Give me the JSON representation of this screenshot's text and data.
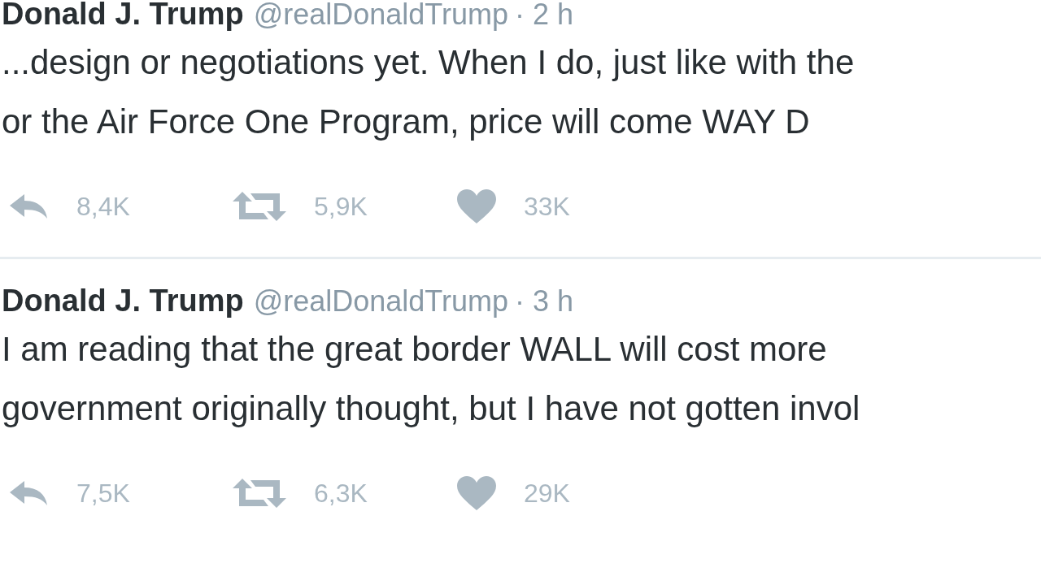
{
  "tweets": [
    {
      "name": "Donald J. Trump",
      "handle": "@realDonaldTrump",
      "time": "· 2 h",
      "lines": [
        "...design or negotiations yet. When I do, just like with the",
        "or the Air Force One Program, price will come WAY D"
      ],
      "replies": "8,4K",
      "retweets": "5,9K",
      "likes": "33K"
    },
    {
      "name": "Donald J. Trump",
      "handle": "@realDonaldTrump",
      "time": "· 3 h",
      "lines": [
        "I am reading that the great border WALL will cost more",
        "government originally thought, but I have not gotten invol"
      ],
      "replies": "7,5K",
      "retweets": "6,3K",
      "likes": "29K"
    }
  ]
}
